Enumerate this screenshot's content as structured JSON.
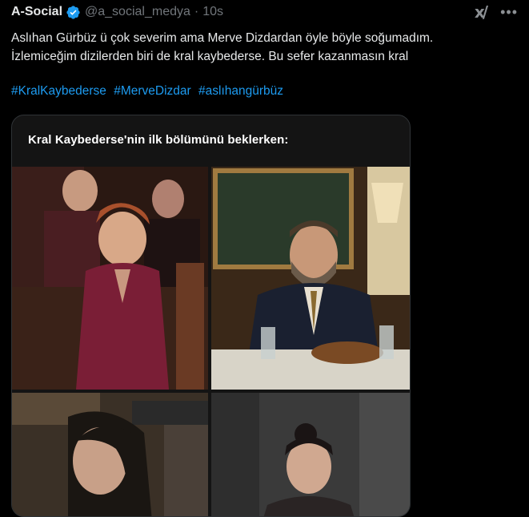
{
  "tweet": {
    "author_name": "A-Social",
    "handle": "@a_social_medya",
    "separator": "·",
    "time": "10s",
    "text_line1": "Aslıhan Gürbüz ü çok severim ama Merve Dizdardan öyle böyle soğumadım.",
    "text_line2": "İzlemiceğim dizilerden biri de kral kaybederse. Bu sefer kazanmasın kral",
    "hashtags": [
      "#KralKaybederse",
      "#MerveDizdar",
      "#aslıhangürbüz"
    ]
  },
  "media": {
    "caption": "Kral Kaybederse'nin ilk bölümünü beklerken:"
  },
  "icons": {
    "verified": "verified-badge-icon",
    "grok": "grok-icon",
    "more": "more-options-icon"
  },
  "colors": {
    "background": "#000000",
    "text": "#e7e9ea",
    "muted": "#71767b",
    "link": "#1d9bf0",
    "verified": "#1d9bf0"
  }
}
